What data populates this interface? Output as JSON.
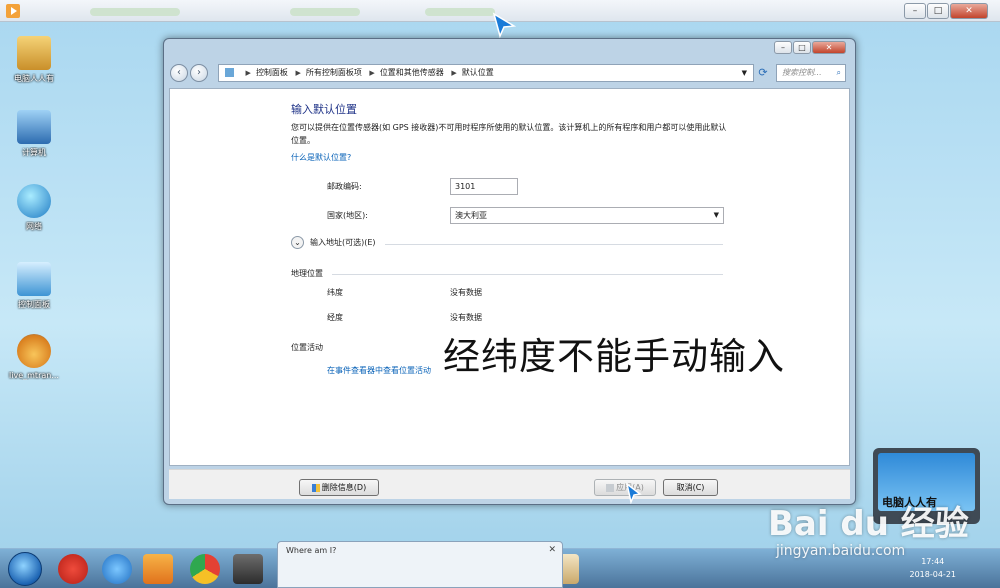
{
  "player": {
    "icon": "play-icon"
  },
  "desktop_icons": [
    {
      "name": "user-folder-icon",
      "label": "电脑人人有",
      "color": "#d9a941"
    },
    {
      "name": "computer-icon",
      "label": "计算机",
      "color": "#3b7fc4"
    },
    {
      "name": "network-icon",
      "label": "网络",
      "color": "#2f8fd4"
    },
    {
      "name": "control-panel-icon",
      "label": "控制面板",
      "color": "#4ea3d9"
    },
    {
      "name": "media-file-icon",
      "label": "live_mtran...",
      "color": "#f1a33c"
    }
  ],
  "window": {
    "nav": {
      "back_icon": "back-arrow-icon",
      "forward_icon": "forward-arrow-icon",
      "breadcrumb": [
        "控制面板",
        "所有控制面板项",
        "位置和其他传感器",
        "默认位置"
      ],
      "search_placeholder": "搜索控制..."
    },
    "heading": "输入默认位置",
    "description": "您可以提供在位置传感器(如 GPS 接收器)不可用时程序所使用的默认位置。该计算机上的所有程序和用户都可以使用此默认位置。",
    "help_link": "什么是默认位置?",
    "postal_label": "邮政编码:",
    "postal_value": "3101",
    "country_label": "国家(地区):",
    "country_value": "澳大利亚",
    "address_toggle": "输入地址(可选)(E)",
    "geo_section": "地理位置",
    "latitude_label": "纬度",
    "latitude_value": "没有数据",
    "longitude_label": "经度",
    "longitude_value": "没有数据",
    "activity_section": "位置活动",
    "activity_link": "在事件查看器中查看位置活动",
    "clear_button": "删除信息(D)",
    "apply_button": "应用(A)",
    "cancel_button": "取消(C)"
  },
  "caption": "经纬度不能手动输入",
  "taskbar": {
    "popup_title": "Where am I?",
    "time": "17:44",
    "date": "2018-04-21"
  },
  "watermark": {
    "badge_text": "电脑人人有",
    "brand": "Bai du 经验",
    "url": "jingyan.baidu.com"
  }
}
